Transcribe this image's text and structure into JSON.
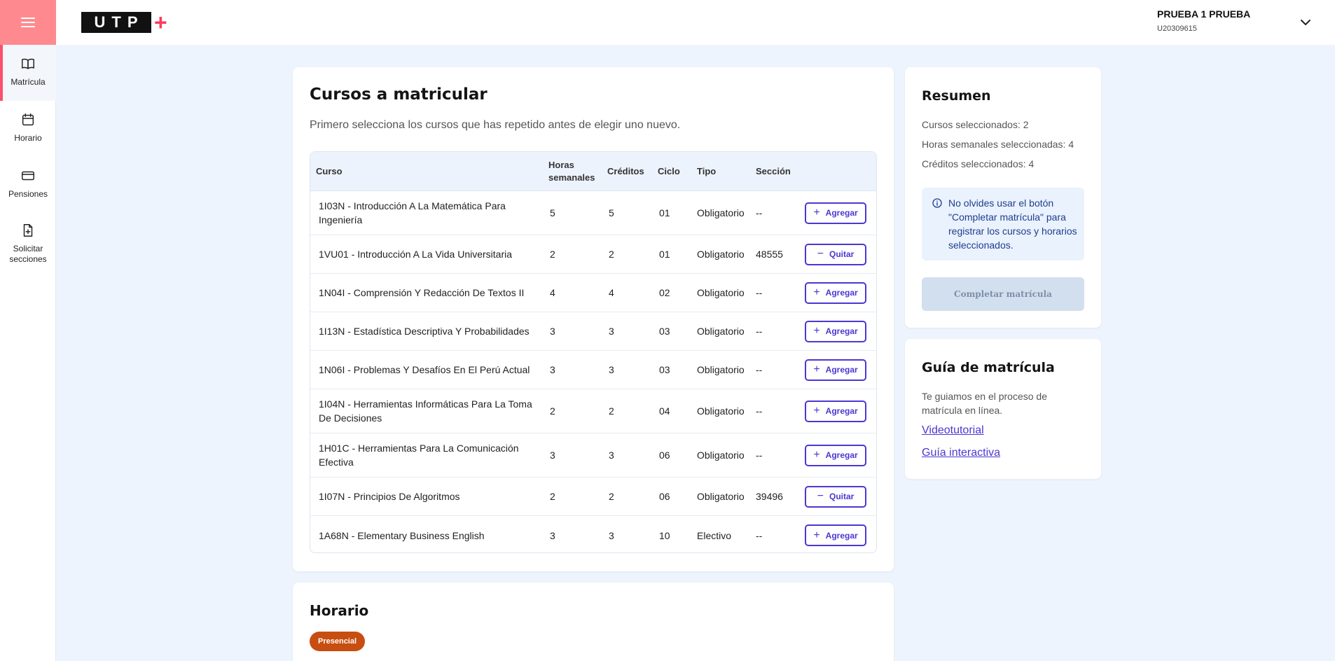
{
  "brand": {
    "logo_text": "UTP",
    "logo_plus": "+"
  },
  "sidebar": {
    "items": [
      {
        "label": "Matrícula",
        "icon": "book-icon"
      },
      {
        "label": "Horario",
        "icon": "calendar-icon"
      },
      {
        "label": "Pensiones",
        "icon": "credit-card-icon"
      },
      {
        "label": "Solicitar secciones",
        "icon": "file-plus-icon"
      }
    ]
  },
  "user": {
    "name": "PRUEBA 1 PRUEBA",
    "code": "U20309615"
  },
  "courses": {
    "title": "Cursos a matricular",
    "subtitle": "Primero selecciona los cursos que has repetido antes de elegir uno nuevo.",
    "columns": {
      "curso": "Curso",
      "horas": "Horas semanales",
      "creditos": "Créditos",
      "ciclo": "Ciclo",
      "tipo": "Tipo",
      "seccion": "Sección"
    },
    "rows": [
      {
        "curso": "1I03N - Introducción A La Matemática Para Ingeniería",
        "horas": "5",
        "creditos": "5",
        "ciclo": "01",
        "tipo": "Obligatorio",
        "seccion": "--",
        "action": "Agregar",
        "action_symbol": "+"
      },
      {
        "curso": "1VU01 - Introducción A La Vida Universitaria",
        "horas": "2",
        "creditos": "2",
        "ciclo": "01",
        "tipo": "Obligatorio",
        "seccion": "48555",
        "action": "Quitar",
        "action_symbol": "−"
      },
      {
        "curso": "1N04I - Comprensión Y Redacción De Textos II",
        "horas": "4",
        "creditos": "4",
        "ciclo": "02",
        "tipo": "Obligatorio",
        "seccion": "--",
        "action": "Agregar",
        "action_symbol": "+"
      },
      {
        "curso": "1I13N - Estadística Descriptiva Y Probabilidades",
        "horas": "3",
        "creditos": "3",
        "ciclo": "03",
        "tipo": "Obligatorio",
        "seccion": "--",
        "action": "Agregar",
        "action_symbol": "+"
      },
      {
        "curso": "1N06I - Problemas Y Desafíos En El Perú Actual",
        "horas": "3",
        "creditos": "3",
        "ciclo": "03",
        "tipo": "Obligatorio",
        "seccion": "--",
        "action": "Agregar",
        "action_symbol": "+"
      },
      {
        "curso": "1I04N - Herramientas Informáticas Para La Toma De Decisiones",
        "horas": "2",
        "creditos": "2",
        "ciclo": "04",
        "tipo": "Obligatorio",
        "seccion": "--",
        "action": "Agregar",
        "action_symbol": "+"
      },
      {
        "curso": "1H01C - Herramientas Para La Comunicación Efectiva",
        "horas": "3",
        "creditos": "3",
        "ciclo": "06",
        "tipo": "Obligatorio",
        "seccion": "--",
        "action": "Agregar",
        "action_symbol": "+"
      },
      {
        "curso": "1I07N - Principios De Algoritmos",
        "horas": "2",
        "creditos": "2",
        "ciclo": "06",
        "tipo": "Obligatorio",
        "seccion": "39496",
        "action": "Quitar",
        "action_symbol": "−"
      },
      {
        "curso": "1A68N - Elementary Business English",
        "horas": "3",
        "creditos": "3",
        "ciclo": "10",
        "tipo": "Electivo",
        "seccion": "--",
        "action": "Agregar",
        "action_symbol": "+"
      }
    ]
  },
  "resumen": {
    "title": "Resumen",
    "cursos": "Cursos seleccionados: 2",
    "horas": "Horas semanales seleccionadas: 4",
    "creditos": "Créditos seleccionados: 4",
    "info": "No olvides usar el botón \"Completar matrícula\" para registrar los cursos y horarios seleccionados.",
    "complete_label": "Completar matrícula"
  },
  "guia": {
    "title": "Guía de matrícula",
    "text": "Te guiamos en el proceso de matrícula en línea.",
    "link1": "Videotutorial",
    "link2": "Guía interactiva"
  },
  "horario": {
    "title": "Horario",
    "badge": "Presencial"
  },
  "colors": {
    "accent": "#4b37d2",
    "menu": "#fe8a8f",
    "active_bar": "#fb4f6b",
    "badge": "#c84d10",
    "background": "#eef4fd"
  }
}
